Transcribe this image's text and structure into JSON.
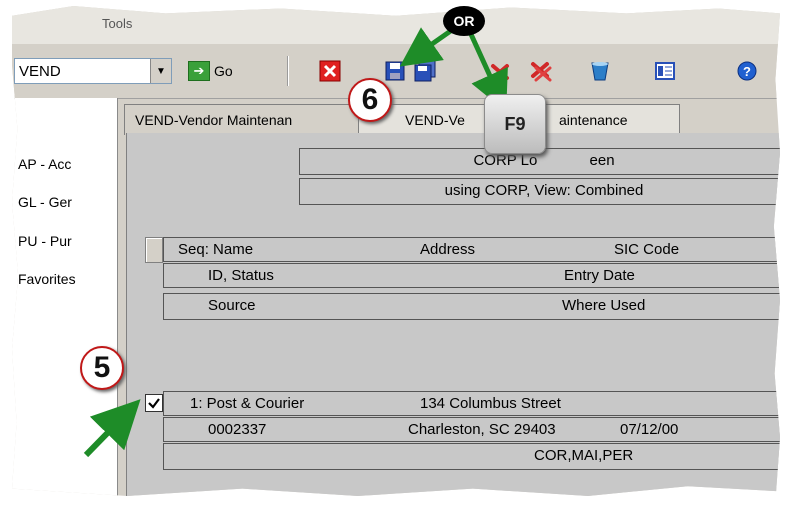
{
  "menubar": {
    "item": "Tools"
  },
  "toolbar": {
    "app_value": "VEND",
    "go_label": "Go",
    "icons": [
      "close-red-icon",
      "save-icon",
      "save-all-icon",
      "delete-icon",
      "delete-all-icon",
      "cup-icon",
      "form-icon",
      "help-icon"
    ]
  },
  "sidebar": {
    "items": [
      "AP - Acc",
      "GL - Ger",
      "PU - Pur",
      "Favorites"
    ]
  },
  "tabs": [
    "VEND-Vendor Maintenan",
    "VEND-Ve",
    "aintenance"
  ],
  "header": {
    "line1": "CORP Lo",
    "line1b": "een",
    "line2": "using CORP, View: Combined"
  },
  "columns": {
    "row1": {
      "seq": "Seq: Name",
      "address": "Address",
      "sic": "SIC Code"
    },
    "row2": {
      "id": "ID, Status",
      "entry": "Entry Date"
    },
    "row3": {
      "source": "Source",
      "where": "Where Used"
    }
  },
  "record": {
    "name": "1: Post & Courier",
    "street": "134 Columbus Street",
    "id": "0002337",
    "city": "Charleston, SC 29403",
    "date": "07/12/00",
    "where": "COR,MAI,PER"
  },
  "annotations": {
    "step5": "5",
    "step6": "6",
    "or": "OR",
    "key": "F9"
  }
}
